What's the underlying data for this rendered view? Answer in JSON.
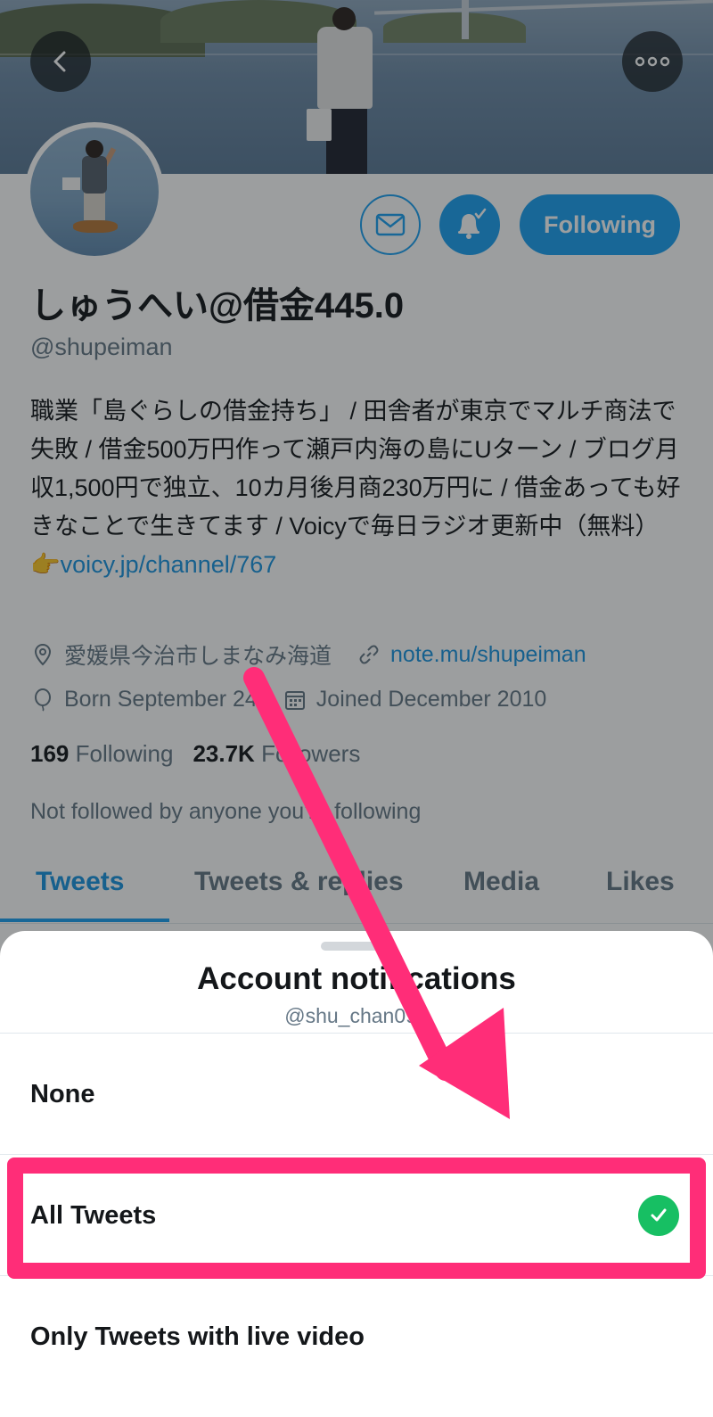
{
  "profile": {
    "display_name": "しゅうへい@借金445.0",
    "handle": "@shupeiman",
    "bio_text": "職業「島ぐらしの借金持ち」 / 田舎者が東京でマルチ商法で失敗 / 借金500万円作って瀬戸内海の島にUターン / ブログ月収1,500円で独立、10カ月後月商230万円に / 借金あっても好きなことで生きてます / Voicyで毎日ラジオ更新中（無料）👉",
    "bio_link": "voicy.jp/channel/767",
    "location": "愛媛県今治市しまなみ海道",
    "website": "note.mu/shupeiman",
    "birthday": "Born September 24",
    "joined": "Joined December 2010",
    "following_count": "169",
    "following_label": "Following",
    "followers_count": "23.7K",
    "followers_label": "Followers",
    "not_followed": "Not followed by anyone you're following",
    "following_button": "Following"
  },
  "tabs": [
    {
      "label": "Tweets",
      "active": true
    },
    {
      "label": "Tweets & replies",
      "active": false
    },
    {
      "label": "Media",
      "active": false
    },
    {
      "label": "Likes",
      "active": false
    }
  ],
  "sheet": {
    "title": "Account notifications",
    "subtitle": "@shu_chan092",
    "options": [
      {
        "label": "None",
        "selected": false
      },
      {
        "label": "All Tweets",
        "selected": true
      },
      {
        "label": "Only Tweets with live video",
        "selected": false
      }
    ]
  },
  "icons": {
    "back": "chevron-left-icon",
    "more": "more-dots-icon",
    "mail": "mail-icon",
    "bell": "bell-check-icon",
    "location": "location-pin-icon",
    "link": "link-icon",
    "birthday": "balloon-icon",
    "calendar": "calendar-icon",
    "check": "check-circle-icon"
  },
  "colors": {
    "accent": "#1da1f2",
    "link": "#1b95e0",
    "muted": "#657786",
    "success": "#17bf63",
    "annotation": "#ff2d78"
  }
}
